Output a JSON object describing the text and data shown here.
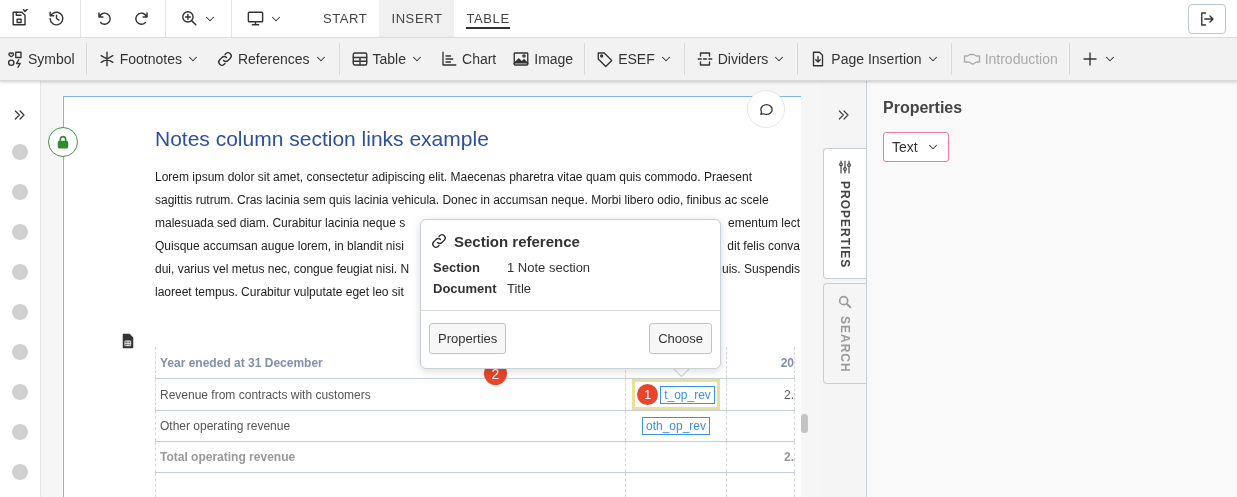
{
  "top_bar": {
    "tabs": [
      {
        "label": "START",
        "selected": false,
        "highlighted": false
      },
      {
        "label": "INSERT",
        "selected": false,
        "highlighted": true
      },
      {
        "label": "TABLE",
        "selected": true,
        "highlighted": false
      }
    ]
  },
  "toolbar": {
    "groups": [
      [
        {
          "label": "Symbol",
          "dropdown": false,
          "disabled": false
        }
      ],
      [
        {
          "label": "Footnotes",
          "dropdown": true,
          "disabled": false
        },
        {
          "label": "References",
          "dropdown": true,
          "disabled": false
        }
      ],
      [
        {
          "label": "Table",
          "dropdown": true,
          "disabled": false
        },
        {
          "label": "Chart",
          "dropdown": false,
          "disabled": false
        },
        {
          "label": "Image",
          "dropdown": false,
          "disabled": false
        }
      ],
      [
        {
          "label": "ESEF",
          "dropdown": true,
          "disabled": false
        }
      ],
      [
        {
          "label": "Dividers",
          "dropdown": true,
          "disabled": false
        }
      ],
      [
        {
          "label": "Page Insertion",
          "dropdown": true,
          "disabled": false
        }
      ],
      [
        {
          "label": "Introduction",
          "dropdown": false,
          "disabled": true
        }
      ],
      [
        {
          "dropdown": true,
          "disabled": false
        }
      ]
    ]
  },
  "document": {
    "title": "Notes column section links example",
    "paragraph_lines": [
      {
        "left": "Lorem ipsum dolor sit amet, consectetur adipiscing elit. Maecenas pharetra vitae quam quis commodo. Praesent"
      },
      {
        "left": "sagittis rutrum. Cras lacinia sem quis lacinia vehicula. Donec in accumsan neque. Morbi libero odio, finibus ac scele"
      },
      {
        "left": "malesuada sed diam. Curabitur lacinia neque s",
        "right": "ementum lect"
      },
      {
        "left": "Quisque accumsan augue lorem, in blandit nisi",
        "right": "dit felis conva"
      },
      {
        "left": "dui, varius vel metus nec, congue feugiat nisi. N",
        "right": "uis. Suspendis"
      },
      {
        "left": "laoreet tempus. Curabitur vulputate eget leo sit"
      }
    ],
    "popup": {
      "title": "Section reference",
      "fields": [
        {
          "label": "Section",
          "value": "1 Note section"
        },
        {
          "label": "Document",
          "value": "Title"
        }
      ],
      "buttons": [
        {
          "label": "Properties",
          "badge": "2"
        },
        {
          "label": "Choose"
        }
      ]
    },
    "table": {
      "rows": [
        {
          "kind": "header",
          "label": "Year eneded at 31 December",
          "value": "20"
        },
        {
          "kind": "line",
          "label": "Revenue from contracts with customers",
          "tag": "t_op_rev",
          "tag_badge": "1",
          "highlighted": true,
          "value": "2."
        },
        {
          "kind": "line",
          "label": "Other operating revenue",
          "tag": "oth_op_rev",
          "highlighted": false
        },
        {
          "kind": "total",
          "label": "Total operating revenue",
          "value": "2."
        }
      ]
    }
  },
  "side_tabs": [
    {
      "label": "PROPERTIES",
      "selected": true
    },
    {
      "label": "SEARCH",
      "selected": false
    }
  ],
  "properties_panel": {
    "title": "Properties",
    "type_select": "Text"
  }
}
